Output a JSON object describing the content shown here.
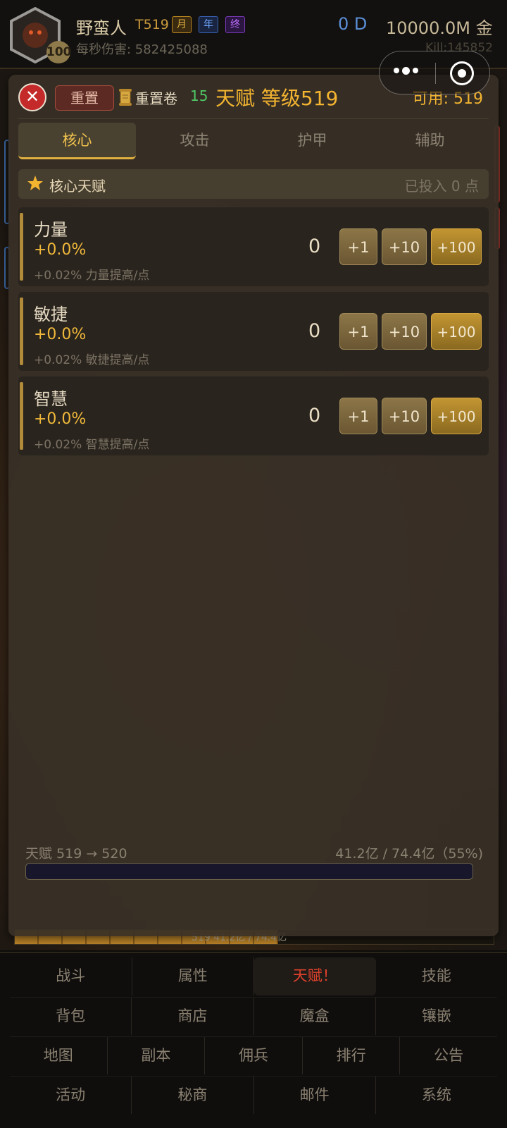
{
  "header": {
    "avatar_level": "100",
    "player_name": "野蛮人",
    "tier": "T519",
    "badges": {
      "month": "月",
      "year": "年",
      "end": "终"
    },
    "dps_label": "每秒伤害: 582425088",
    "currency_d": "0 D",
    "gold": "10000.0M 金",
    "kills": "Kill:145852"
  },
  "background": {
    "progress_text": "519  41.2亿 / 74.4亿",
    "progress_fraction": 0.55
  },
  "panel": {
    "reset_label": "重置",
    "scroll_label": "重置卷",
    "scroll_count": "15",
    "title": "天赋 等级519",
    "available": "可用: 519",
    "tabs": [
      "核心",
      "攻击",
      "护甲",
      "辅助"
    ],
    "active_tab": 0,
    "section": {
      "title": "核心天赋",
      "invested": "已投入 0 点"
    },
    "stats": [
      {
        "name": "力量",
        "pct": "+0.0%",
        "desc": "+0.02% 力量提高/点",
        "points": "0"
      },
      {
        "name": "敏捷",
        "pct": "+0.0%",
        "desc": "+0.02% 敏捷提高/点",
        "points": "0"
      },
      {
        "name": "智慧",
        "pct": "+0.0%",
        "desc": "+0.02% 智慧提高/点",
        "points": "0"
      }
    ],
    "buttons": {
      "plus1": "+1",
      "plus10": "+10",
      "plus100": "+100"
    },
    "level_progress": "天赋 519 → 520",
    "xp_progress": "41.2亿 / 74.4亿（55%)",
    "xp_fraction": 0.55
  },
  "nav": {
    "rows": [
      [
        "战斗",
        "属性",
        "天赋！",
        "技能"
      ],
      [
        "背包",
        "商店",
        "魔盒",
        "镶嵌"
      ],
      [
        "地图",
        "副本",
        "佣兵",
        "排行",
        "公告"
      ],
      [
        "活动",
        "秘商",
        "邮件",
        "系统"
      ]
    ],
    "active": "天赋！"
  },
  "colors": {
    "accent_gold": "#f3b430",
    "active_nav": "#e0412c",
    "scroll_count": "#4fc864",
    "close_red": "#c42a2a"
  },
  "icons": [
    "close-icon",
    "scroll-icon",
    "star-icon",
    "more-dots-icon",
    "target-icon"
  ]
}
